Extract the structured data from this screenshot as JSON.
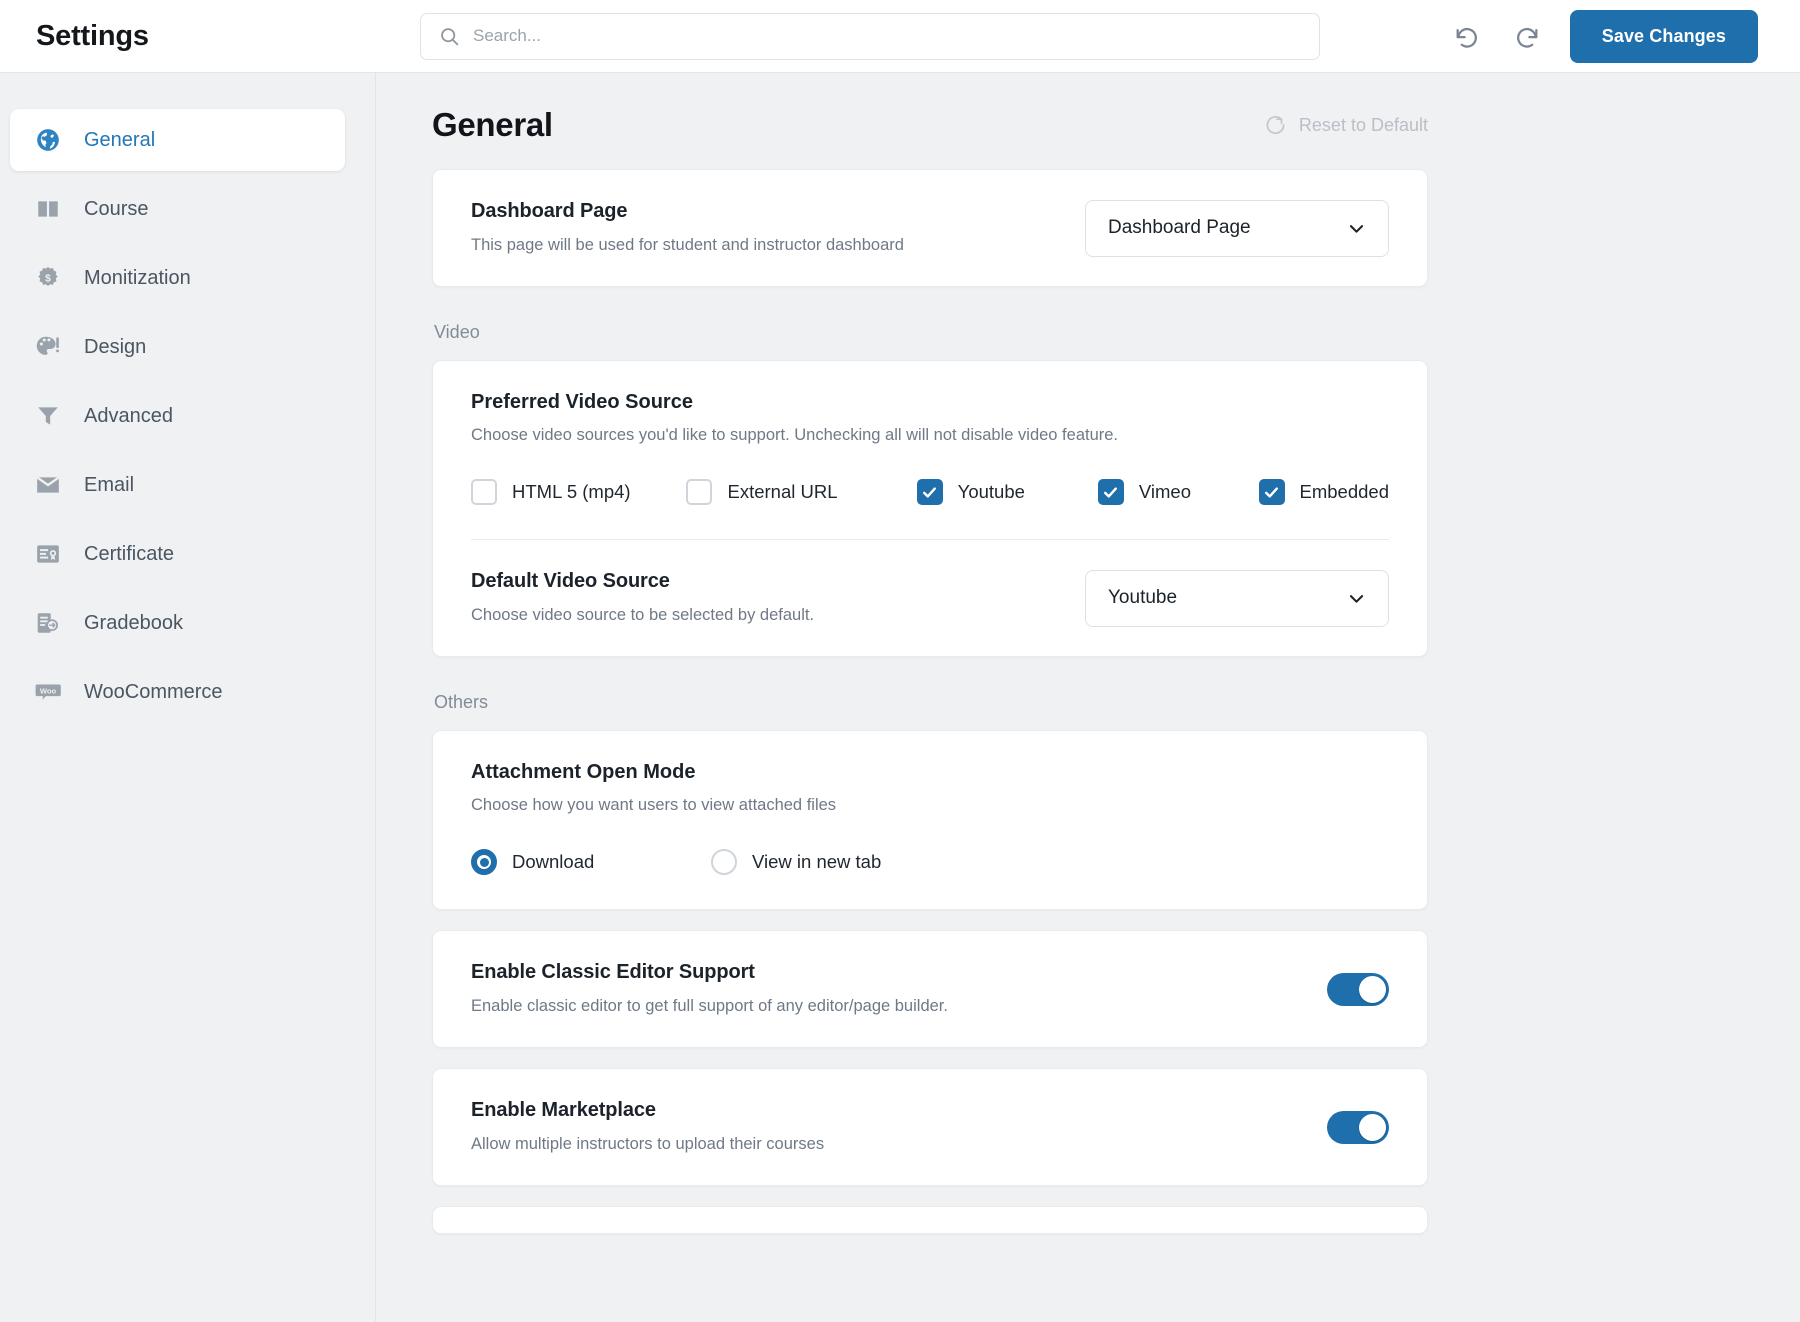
{
  "header": {
    "app_title": "Settings",
    "search": {
      "placeholder": "Search...",
      "value": ""
    },
    "undo_icon": "undo-icon",
    "redo_icon": "redo-icon",
    "save_label": "Save Changes",
    "accent_color": "#1f6fad"
  },
  "sidebar": {
    "items": [
      {
        "label": "General",
        "icon": "globe-icon",
        "active": true
      },
      {
        "label": "Course",
        "icon": "book-icon",
        "active": false
      },
      {
        "label": "Monitization",
        "icon": "dollar-badge-icon",
        "active": false
      },
      {
        "label": "Design",
        "icon": "palette-icon",
        "active": false
      },
      {
        "label": "Advanced",
        "icon": "funnel-icon",
        "active": false
      },
      {
        "label": "Email",
        "icon": "envelope-icon",
        "active": false
      },
      {
        "label": "Certificate",
        "icon": "certificate-icon",
        "active": false
      },
      {
        "label": "Gradebook",
        "icon": "gradebook-icon",
        "active": false
      },
      {
        "label": "WooCommerce",
        "icon": "woo-icon",
        "active": false
      }
    ]
  },
  "main": {
    "page_title": "General",
    "reset_label": "Reset to Default",
    "reset_icon": "refresh-icon",
    "dashboard": {
      "title": "Dashboard Page",
      "desc": "This page will be used for student and instructor dashboard",
      "select_value": "Dashboard Page"
    },
    "video_section_label": "Video",
    "preferred_video": {
      "title": "Preferred Video Source",
      "desc": "Choose video sources you'd like to support. Unchecking all will not disable video feature.",
      "options": [
        {
          "label": "HTML 5 (mp4)",
          "checked": false
        },
        {
          "label": "External URL",
          "checked": false
        },
        {
          "label": "Youtube",
          "checked": true
        },
        {
          "label": "Vimeo",
          "checked": true
        },
        {
          "label": "Embedded",
          "checked": true
        }
      ]
    },
    "default_video": {
      "title": "Default Video Source",
      "desc": "Choose video source to be selected by default.",
      "select_value": "Youtube"
    },
    "others_section_label": "Others",
    "attachment": {
      "title": "Attachment Open Mode",
      "desc": "Choose how you want users to view attached files",
      "options": [
        {
          "label": "Download",
          "selected": true
        },
        {
          "label": "View in new tab",
          "selected": false
        }
      ]
    },
    "classic_editor": {
      "title": "Enable Classic Editor Support",
      "desc": "Enable classic editor to get full support of any editor/page builder.",
      "enabled": true
    },
    "marketplace": {
      "title": "Enable Marketplace",
      "desc": "Allow multiple instructors to upload their courses",
      "enabled": true
    }
  }
}
